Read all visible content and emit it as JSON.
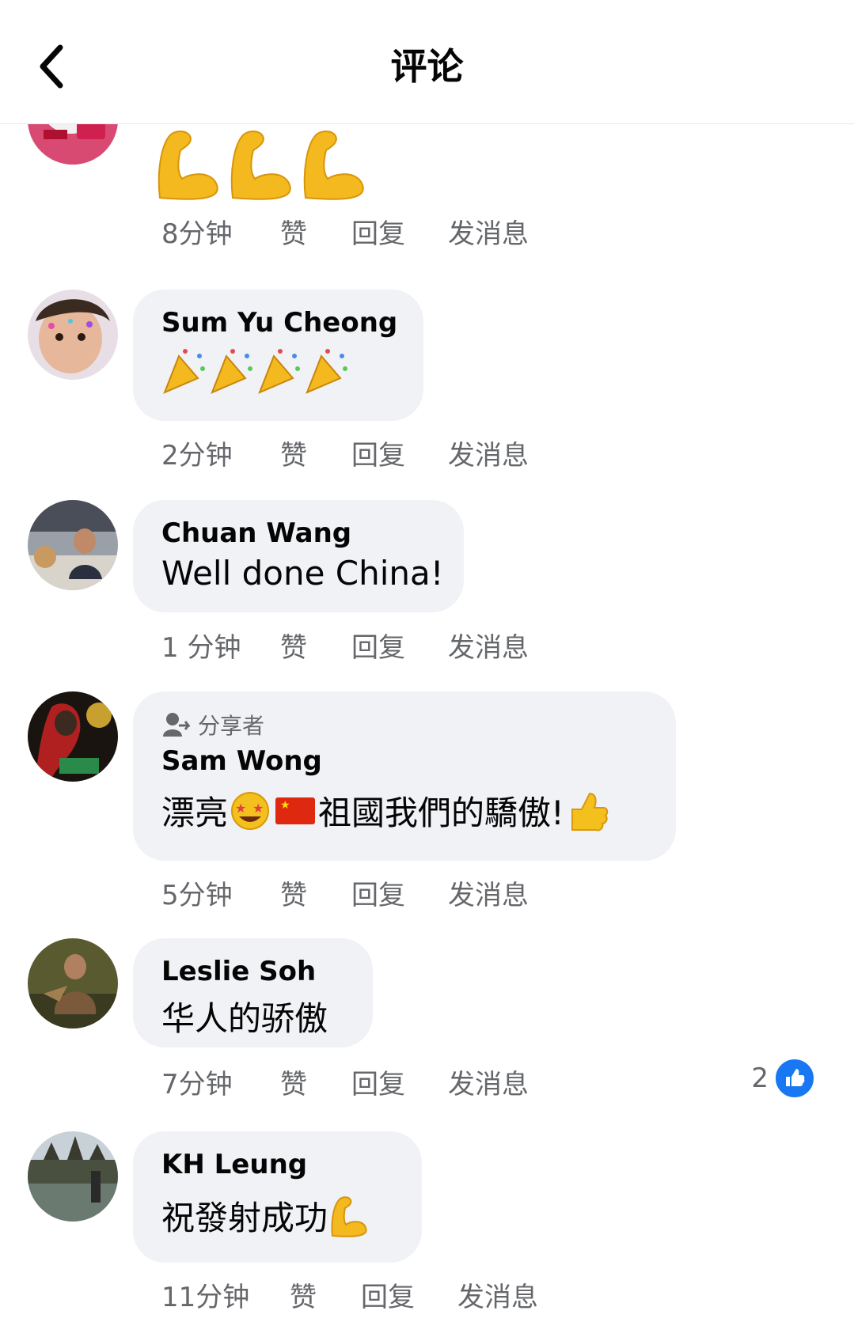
{
  "header": {
    "title": "评论"
  },
  "actions": {
    "like": "赞",
    "reply": "回复",
    "message": "发消息"
  },
  "comments": [
    {
      "author": "",
      "text": "💪💪💪",
      "time": "8分钟"
    },
    {
      "author": "Sum Yu  Cheong",
      "text": "🎉🎉🎉🎉",
      "time": "2分钟"
    },
    {
      "author": "Chuan Wang",
      "text": "Well done China!",
      "time": "1 分钟"
    },
    {
      "author": "Sam Wong",
      "sharer_label": "分享者",
      "text_a": "漂亮",
      "text_b": "祖國我們的驕傲!",
      "time": "5分钟"
    },
    {
      "author": "Leslie Soh",
      "text": "华人的骄傲",
      "time": "7分钟",
      "likes": "2"
    },
    {
      "author": "KH Leung",
      "text": "祝發射成功",
      "time": "11分钟"
    }
  ],
  "colors": {
    "like_blue": "#1877f2",
    "bubble": "#f0f2f5",
    "meta": "#65676b"
  }
}
